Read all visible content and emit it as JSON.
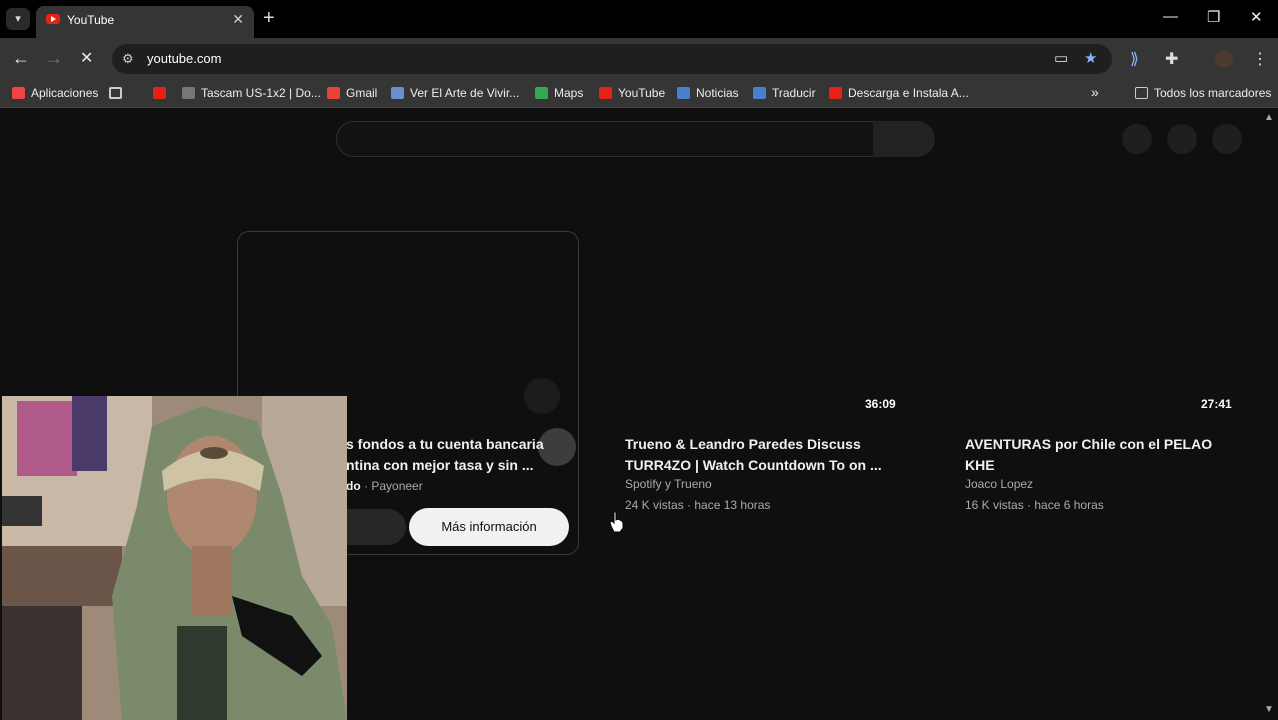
{
  "browser": {
    "tab_title": "YouTube",
    "url": "youtube.com",
    "bookmarks": [
      {
        "label": "Aplicaciones",
        "color": "#e44"
      },
      {
        "label": "",
        "color": "#888"
      },
      {
        "label": "",
        "color": "#e62117"
      },
      {
        "label": "Tascam US-1x2 | Do...",
        "color": "#777"
      },
      {
        "label": "Gmail",
        "color": "#ea4335"
      },
      {
        "label": "Ver El Arte de Vivir...",
        "color": "#6a8fd0"
      },
      {
        "label": "Maps",
        "color": "#34a853"
      },
      {
        "label": "YouTube",
        "color": "#e62117"
      },
      {
        "label": "Noticias",
        "color": "#4a7fd0"
      },
      {
        "label": "Traducir",
        "color": "#4a7fd0"
      },
      {
        "label": "Descarga e Instala A...",
        "color": "#e62117"
      }
    ],
    "all_bookmarks": "Todos los marcadores"
  },
  "ad": {
    "title": "s fondos a tu cuenta bancaria\nntina con mejor tasa y sin ...",
    "meta_bold": "do",
    "meta_rest": " · Payoneer",
    "cta": "Más información"
  },
  "videos": [
    {
      "duration": "36:09",
      "title": "Trueno & Leandro Paredes Discuss TURR4ZO | Watch Countdown To on ...",
      "channel": "Spotify      y Trueno",
      "stats": "24 K vistas · hace 13 horas"
    },
    {
      "duration": "27:41",
      "title": "AVENTURAS por Chile con el PELAO KHE",
      "channel": "Joaco Lopez",
      "stats": "16 K vistas · hace 6 horas"
    }
  ]
}
